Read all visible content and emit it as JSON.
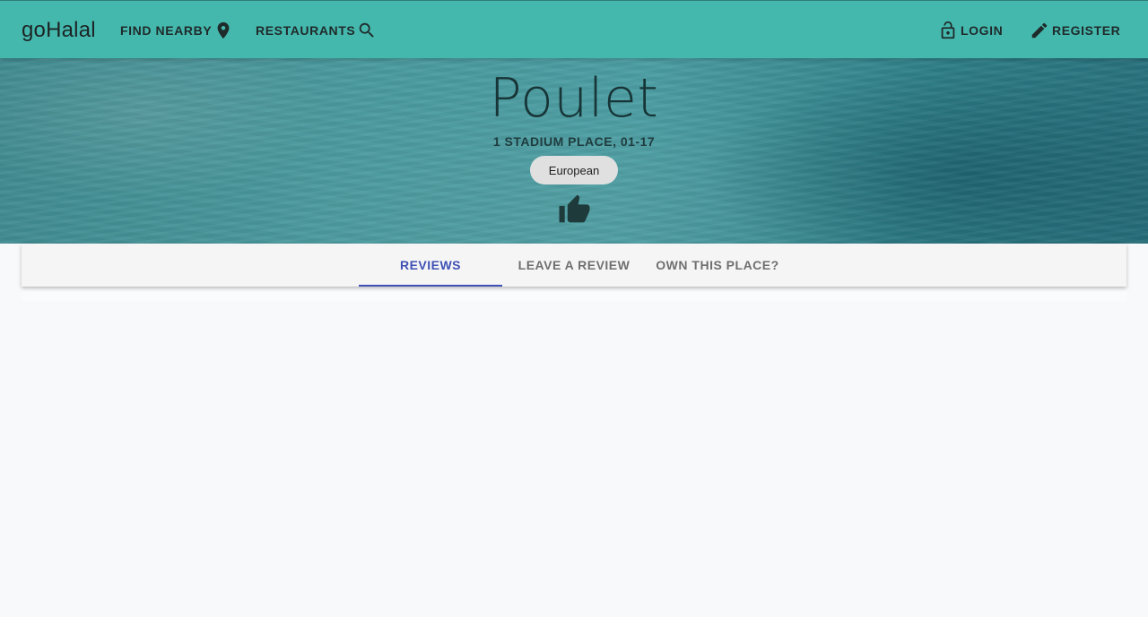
{
  "appbar": {
    "brand": "goHalal",
    "find_nearby": "FIND NEARBY",
    "restaurants": "RESTAURANTS",
    "login": "LOGIN",
    "register": "REGISTER",
    "color": "#45b8ae"
  },
  "restaurant": {
    "name": "Poulet",
    "address": "1 STADIUM PLACE, 01-17",
    "cuisine": "European"
  },
  "tabs": {
    "items": [
      {
        "label": "REVIEWS",
        "active": true
      },
      {
        "label": "LEAVE A REVIEW",
        "active": false
      },
      {
        "label": "OWN THIS PLACE?",
        "active": false
      }
    ],
    "accent": "#3f51b5"
  },
  "icons": {
    "find_nearby": "location-pin-icon",
    "restaurants": "search-icon",
    "login": "lock-open-icon",
    "register": "pencil-icon",
    "like": "thumbs-up-icon"
  }
}
